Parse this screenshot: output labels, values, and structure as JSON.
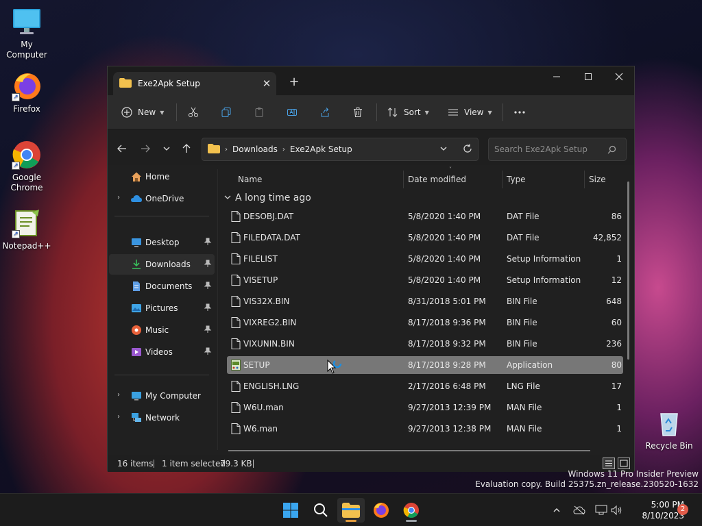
{
  "desktop": {
    "icons": [
      {
        "label": "My Computer"
      },
      {
        "label": "Firefox"
      },
      {
        "label": "Google Chrome"
      },
      {
        "label": "Notepad++"
      },
      {
        "label": "Recycle Bin"
      }
    ]
  },
  "window": {
    "tab_title": "Exe2Apk Setup",
    "toolbar": {
      "new_label": "New",
      "sort_label": "Sort",
      "view_label": "View"
    },
    "address": {
      "crumbs": [
        "Downloads",
        "Exe2Apk Setup"
      ]
    },
    "search": {
      "placeholder": "Search Exe2Apk Setup"
    },
    "sidebar": {
      "top": [
        {
          "label": "Home"
        },
        {
          "label": "OneDrive"
        }
      ],
      "pinned": [
        {
          "label": "Desktop"
        },
        {
          "label": "Downloads"
        },
        {
          "label": "Documents"
        },
        {
          "label": "Pictures"
        },
        {
          "label": "Music"
        },
        {
          "label": "Videos"
        }
      ],
      "bottom": [
        {
          "label": "My Computer"
        },
        {
          "label": "Network"
        }
      ]
    },
    "columns": {
      "name": "Name",
      "date": "Date modified",
      "type": "Type",
      "size": "Size"
    },
    "group_label": "A long time ago",
    "files": [
      {
        "name": "DESOBJ.DAT",
        "date": "5/8/2020 1:40 PM",
        "type": "DAT File",
        "size": "86"
      },
      {
        "name": "FILEDATA.DAT",
        "date": "5/8/2020 1:40 PM",
        "type": "DAT File",
        "size": "42,852"
      },
      {
        "name": "FILELIST",
        "date": "5/8/2020 1:40 PM",
        "type": "Setup Information",
        "size": "1"
      },
      {
        "name": "VISETUP",
        "date": "5/8/2020 1:40 PM",
        "type": "Setup Information",
        "size": "12"
      },
      {
        "name": "VIS32X.BIN",
        "date": "8/31/2018 5:01 PM",
        "type": "BIN File",
        "size": "648"
      },
      {
        "name": "VIXREG2.BIN",
        "date": "8/17/2018 9:36 PM",
        "type": "BIN File",
        "size": "60"
      },
      {
        "name": "VIXUNIN.BIN",
        "date": "8/17/2018 9:32 PM",
        "type": "BIN File",
        "size": "236"
      },
      {
        "name": "SETUP",
        "date": "8/17/2018 9:28 PM",
        "type": "Application",
        "size": "80"
      },
      {
        "name": "ENGLISH.LNG",
        "date": "2/17/2016 6:48 PM",
        "type": "LNG File",
        "size": "17"
      },
      {
        "name": "W6U.man",
        "date": "9/27/2013 12:39 PM",
        "type": "MAN File",
        "size": "1"
      },
      {
        "name": "W6.man",
        "date": "9/27/2013 12:38 PM",
        "type": "MAN File",
        "size": "1"
      }
    ],
    "status": {
      "items": "16 items",
      "selected": "1 item selected",
      "size": "79.3 KB"
    }
  },
  "watermark": {
    "line1": "Windows 11 Pro Insider Preview",
    "line2": "Evaluation copy. Build 25375.zn_release.230520-1632"
  },
  "taskbar": {
    "time": "5:00 PM",
    "date": "8/10/2023",
    "notification_count": "2"
  },
  "colors": {
    "selection": "#777777",
    "folder": "#f2c14e",
    "accent": "#0078d4"
  }
}
